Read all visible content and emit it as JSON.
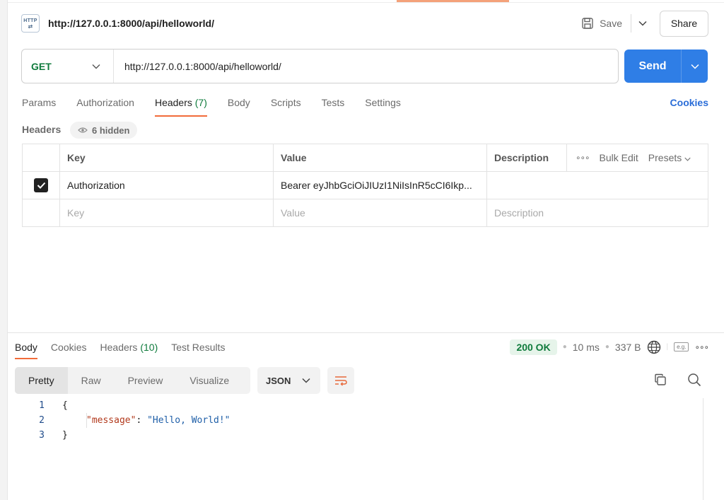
{
  "request": {
    "icon_label": "HTTP",
    "title": "http://127.0.0.1:8000/api/helloworld/",
    "save_label": "Save",
    "share_label": "Share",
    "method": "GET",
    "url": "http://127.0.0.1:8000/api/helloworld/",
    "send_label": "Send"
  },
  "request_tabs": {
    "params": "Params",
    "authorization": "Authorization",
    "headers": "Headers",
    "headers_count": "(7)",
    "body": "Body",
    "scripts": "Scripts",
    "tests": "Tests",
    "settings": "Settings",
    "cookies": "Cookies"
  },
  "headers_section": {
    "label": "Headers",
    "hidden": "6 hidden",
    "columns": {
      "key": "Key",
      "value": "Value",
      "description": "Description"
    },
    "bulk_edit": "Bulk Edit",
    "presets": "Presets",
    "rows": [
      {
        "checked": true,
        "key": "Authorization",
        "value": "Bearer eyJhbGciOiJIUzI1NiIsInR5cCI6Ikp...",
        "description": ""
      }
    ],
    "placeholders": {
      "key": "Key",
      "value": "Value",
      "description": "Description"
    }
  },
  "response": {
    "tabs": {
      "body": "Body",
      "cookies": "Cookies",
      "headers": "Headers",
      "headers_count": "(10)",
      "test_results": "Test Results"
    },
    "status": "200 OK",
    "time": "10 ms",
    "size": "337 B",
    "eg_label": "e.g.",
    "formats": {
      "pretty": "Pretty",
      "raw": "Raw",
      "preview": "Preview",
      "visualize": "Visualize"
    },
    "language": "JSON",
    "lines": [
      {
        "n": "1",
        "open": "{"
      },
      {
        "n": "2",
        "key": "\"message\"",
        "sep": ": ",
        "str": "\"Hello, World!\""
      },
      {
        "n": "3",
        "close": "}"
      }
    ]
  },
  "colors": {
    "send": "#2f7ee6",
    "method_get": "#0f7b3c",
    "active_tab_underline": "#f26b3a",
    "status_ok": "#0f7b3c",
    "link": "#2a6dd8"
  }
}
